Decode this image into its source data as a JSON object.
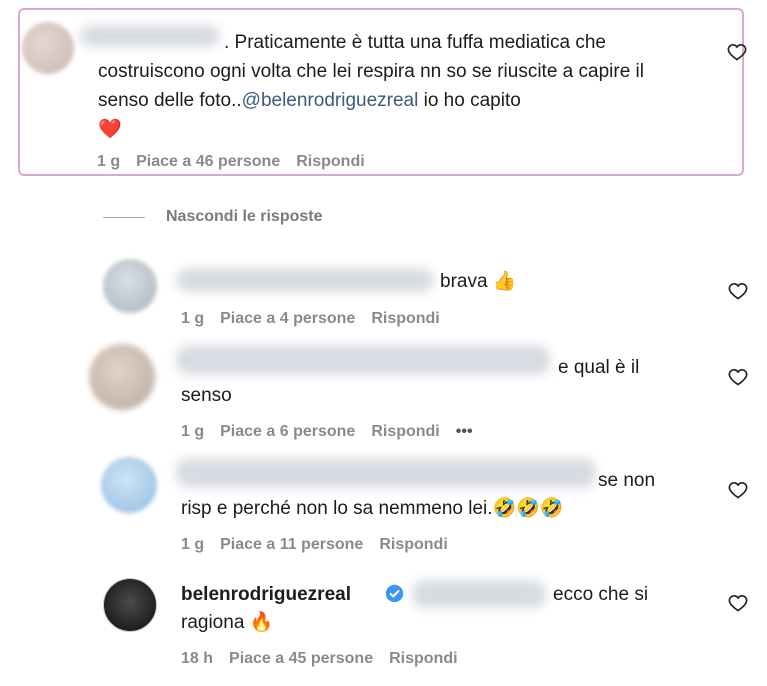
{
  "comments": [
    {
      "text": ". Praticamente è tutta una fuffa mediatica che costruiscono ogni volta che lei respira nn so se riuscite a capire il senso delle foto..",
      "mention": "@belenrodriguezreal",
      "tail": " io ho capito",
      "emoji": "❤️",
      "time": "1 g",
      "likes": "Piace a 46 persone",
      "reply": "Rispondi"
    }
  ],
  "thread": {
    "toggle": "Nascondi le risposte"
  },
  "replies": [
    {
      "text": "brava",
      "emoji": "👍",
      "time": "1 g",
      "likes": "Piace a 4 persone",
      "reply": "Rispondi"
    },
    {
      "text": "e qual è il",
      "text2": "senso",
      "time": "1 g",
      "likes": "Piace a 6 persone",
      "reply": "Rispondi",
      "more": "•••"
    },
    {
      "text": "se non",
      "text2": "risp e perché non lo sa nemmeno lei.",
      "emoji": "🤣🤣🤣",
      "time": "1 g",
      "likes": "Piace a 11 persone",
      "reply": "Rispondi"
    },
    {
      "username": "belenrodriguezreal",
      "text": "ecco che si",
      "text2": "ragiona",
      "emoji": "🔥",
      "time": "18 h",
      "likes": "Piace a 45 persone",
      "reply": "Rispondi"
    }
  ],
  "colors": {
    "highlight_border": "#d9a7cf",
    "mention": "#3d5a80",
    "verified": "#3897f0"
  },
  "icons": [
    "heart-icon",
    "verified-badge-icon",
    "more-icon"
  ]
}
